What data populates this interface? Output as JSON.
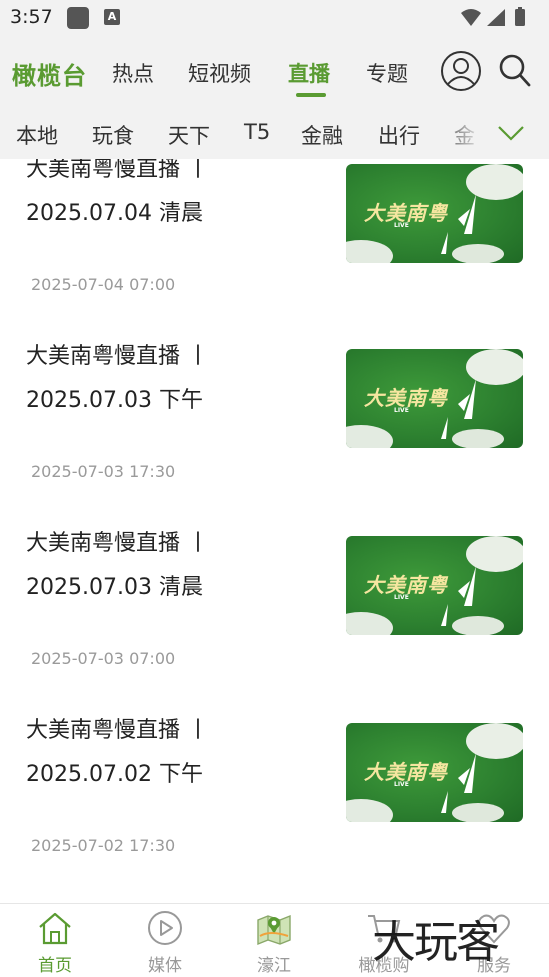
{
  "status": {
    "time": "3:57",
    "app_badge": "A"
  },
  "header": {
    "brand": "橄榄台",
    "tabs": [
      {
        "label": "热点",
        "active": false
      },
      {
        "label": "短视频",
        "active": false
      },
      {
        "label": "直播",
        "active": true
      },
      {
        "label": "专题",
        "active": false
      }
    ]
  },
  "categories": [
    "本地",
    "玩食",
    "天下",
    "T5",
    "金融",
    "出行",
    "金"
  ],
  "items": [
    {
      "title_line1": "大美南粤慢直播 丨",
      "title_line2": "2025.07.04 清晨",
      "time": "2025-07-04 07:00",
      "thumb_title": "大美南粤",
      "thumb_live": "LIVE"
    },
    {
      "title_line1": "大美南粤慢直播 丨",
      "title_line2": "2025.07.03 下午",
      "time": "2025-07-03 17:30",
      "thumb_title": "大美南粤",
      "thumb_live": "LIVE"
    },
    {
      "title_line1": "大美南粤慢直播 丨",
      "title_line2": "2025.07.03 清晨",
      "time": "2025-07-03 07:00",
      "thumb_title": "大美南粤",
      "thumb_live": "LIVE"
    },
    {
      "title_line1": "大美南粤慢直播 丨",
      "title_line2": "2025.07.02 下午",
      "time": "2025-07-02 17:30",
      "thumb_title": "大美南粤",
      "thumb_live": "LIVE"
    }
  ],
  "bottom_nav": [
    {
      "label": "首页",
      "icon": "home-icon",
      "active": true
    },
    {
      "label": "媒体",
      "icon": "play-icon",
      "active": false
    },
    {
      "label": "濠江",
      "icon": "map-icon",
      "active": false
    },
    {
      "label": "橄榄购",
      "icon": "cart-icon",
      "active": false
    },
    {
      "label": "服务",
      "icon": "heart-icon",
      "active": false
    }
  ],
  "watermark": "大玩客",
  "colors": {
    "accent": "#5a9b32",
    "header_bg": "#f2f2f2",
    "muted_text": "#9a9a9a"
  }
}
